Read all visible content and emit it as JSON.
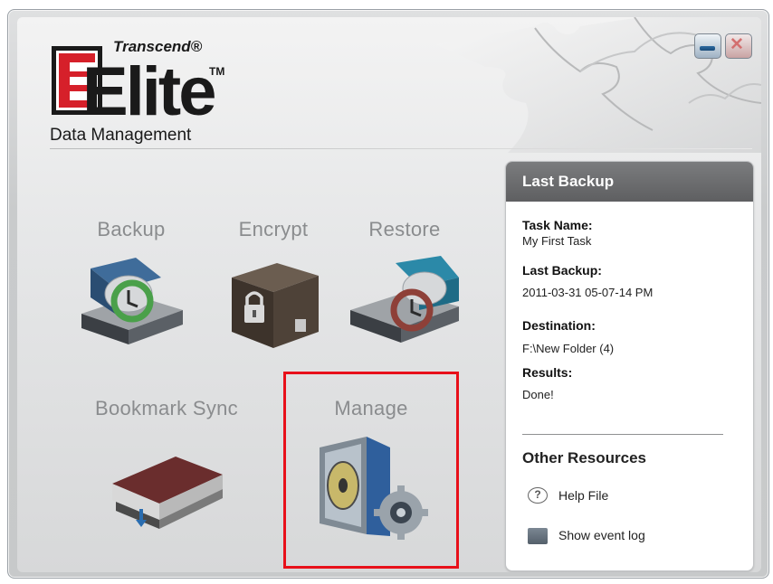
{
  "app": {
    "brand": "Transcend®",
    "logo_word": "Elite",
    "trademark": "TM",
    "subtitle": "Data Management"
  },
  "window_buttons": {
    "close_glyph": "✕"
  },
  "tiles": {
    "backup": "Backup",
    "encrypt": "Encrypt",
    "restore": "Restore",
    "bookmark_sync": "Bookmark Sync",
    "manage": "Manage"
  },
  "last_backup": {
    "header": "Last Backup",
    "task_name_label": "Task Name:",
    "task_name_value": "My First Task",
    "last_backup_label": "Last Backup:",
    "last_backup_value": "2011-03-31 05-07-14 PM",
    "destination_label": "Destination:",
    "destination_value": "F:\\New Folder (4)",
    "results_label": "Results:",
    "results_value": "Done!"
  },
  "other_resources": {
    "title": "Other Resources",
    "help_file": "Help File",
    "help_icon_glyph": "?",
    "show_event_log": "Show event log"
  },
  "colors": {
    "highlight": "#e8101a",
    "logo_red": "#d6202a",
    "panel_header": "#6a6b6d"
  }
}
